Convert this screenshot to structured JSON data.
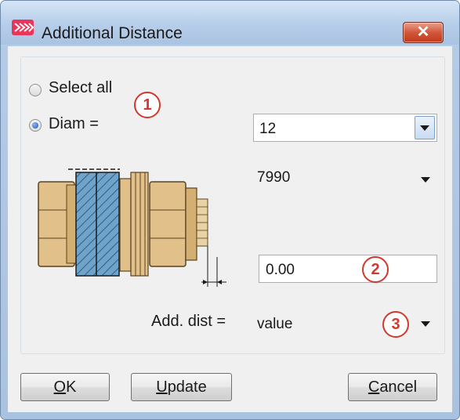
{
  "window": {
    "title": "Additional Distance",
    "close_symbol": "✕"
  },
  "options": {
    "select_all_label": "Select all",
    "diam_label": "Diam =",
    "selected": "diam"
  },
  "diam_select": {
    "value": "12"
  },
  "standard_select": {
    "value": "7990"
  },
  "distance_input": {
    "value": "0.00"
  },
  "add_dist": {
    "label": "Add. dist =",
    "value": "value"
  },
  "callouts": {
    "one": "1",
    "two": "2",
    "three": "3"
  },
  "buttons": {
    "ok": {
      "mnemonic": "O",
      "rest": "K"
    },
    "update": {
      "mnemonic": "U",
      "rest": "pdate"
    },
    "cancel": {
      "mnemonic": "C",
      "rest": "ancel"
    }
  },
  "icons": {
    "app": "app-logo-icon",
    "close": "close-icon",
    "dropdown": "chevron-down-icon",
    "illustration": "bolt-assembly-illustration"
  },
  "colors": {
    "accent_red": "#d0392b",
    "titlebar_blue": "#b8cfea",
    "dialog_bg": "#f0f0f0",
    "close_red": "#c03a1c"
  }
}
